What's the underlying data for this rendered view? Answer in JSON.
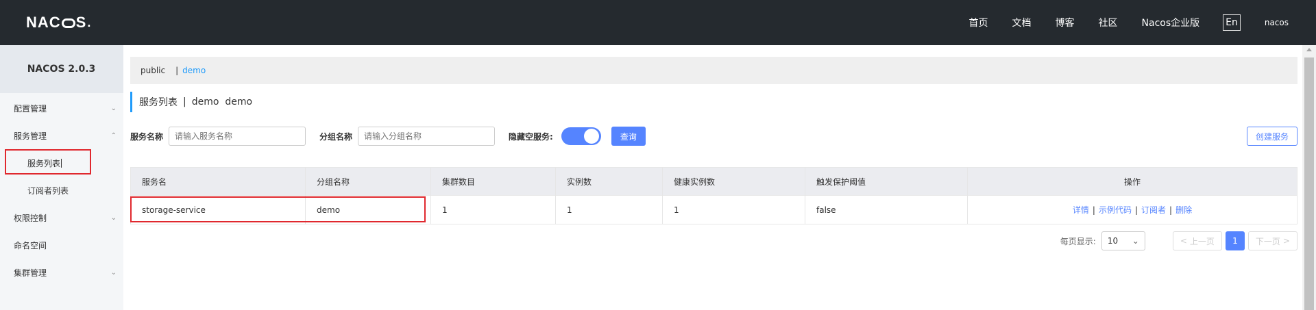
{
  "header": {
    "logo": {
      "n": "N",
      "a": "A",
      "c": "C",
      "s": "S",
      "dot": "."
    },
    "nav": [
      "首页",
      "文档",
      "博客",
      "社区",
      "Nacos企业版"
    ],
    "lang": "En",
    "user": "nacos"
  },
  "sidebar": {
    "version": "NACOS 2.0.3",
    "items": [
      {
        "label": "配置管理",
        "chevron": "down"
      },
      {
        "label": "服务管理",
        "chevron": "up"
      },
      {
        "label": "服务列表",
        "chevron": ""
      },
      {
        "label": "订阅者列表",
        "chevron": ""
      },
      {
        "label": "权限控制",
        "chevron": "down"
      },
      {
        "label": "命名空间",
        "chevron": ""
      },
      {
        "label": "集群管理",
        "chevron": "down"
      }
    ]
  },
  "breadcrumb": {
    "public": "public",
    "sep": "|",
    "demo": "demo"
  },
  "title": {
    "main": "服务列表",
    "pipe": "|",
    "ns": "demo  demo"
  },
  "filters": {
    "service_label": "服务名称",
    "service_placeholder": "请输入服务名称",
    "group_label": "分组名称",
    "group_placeholder": "请输入分组名称",
    "hide_empty_label": "隐藏空服务:",
    "hide_empty_on": true,
    "query_button": "查询",
    "create_button": "创建服务"
  },
  "table": {
    "columns": [
      "服务名",
      "分组名称",
      "集群数目",
      "实例数",
      "健康实例数",
      "触发保护阈值",
      "操作"
    ],
    "rows": [
      {
        "service": "storage-service",
        "group": "demo",
        "clusters": "1",
        "instances": "1",
        "healthy": "1",
        "threshold": "false"
      }
    ],
    "ops": {
      "detail": "详情",
      "sample": "示例代码",
      "subscriber": "订阅者",
      "delete": "删除",
      "sep": "|"
    }
  },
  "pagination": {
    "page_size_label": "每页显示:",
    "page_size": "10",
    "prev": "上一页",
    "next": "下一页",
    "current": "1"
  },
  "colors": {
    "accent": "#5584ff",
    "topbar": "#252a2f",
    "highlight": "#e0282e"
  }
}
